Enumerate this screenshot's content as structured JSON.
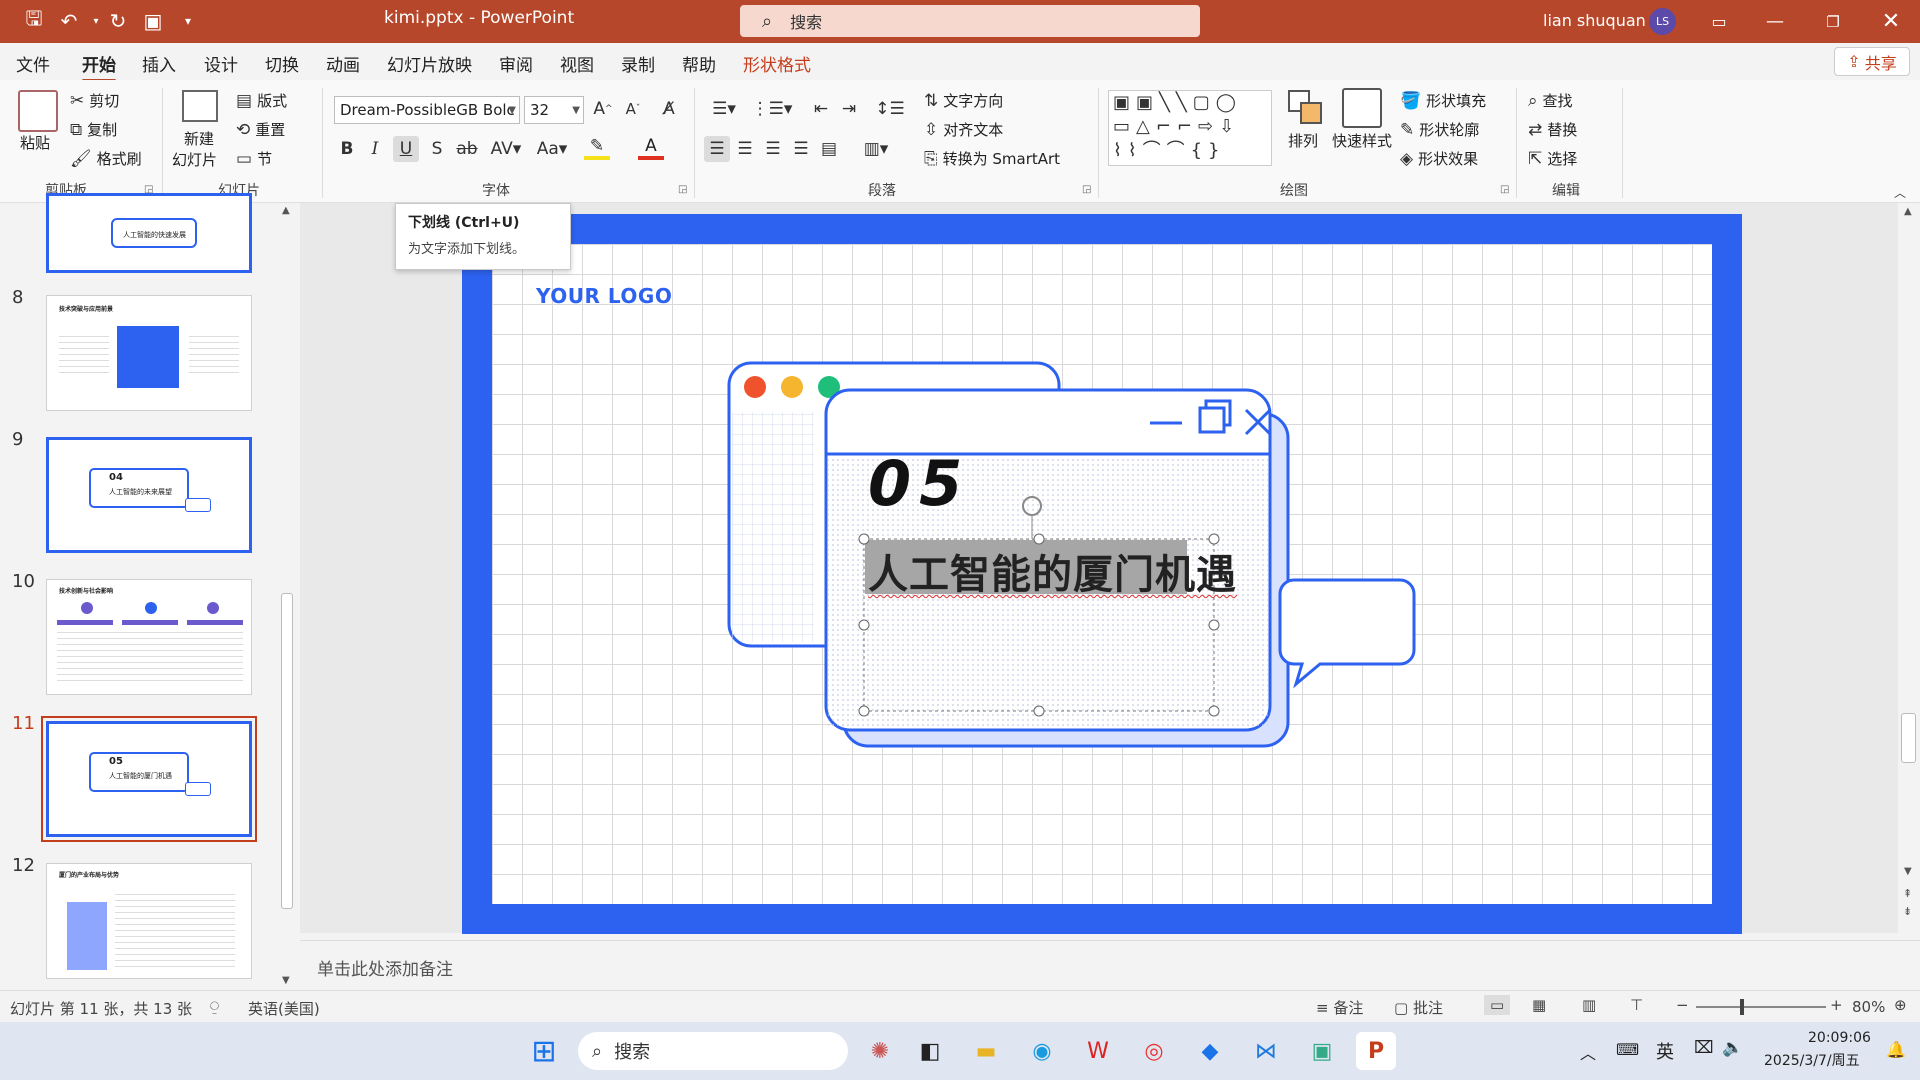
{
  "titlebar": {
    "title": "kimi.pptx  -  PowerPoint",
    "search_placeholder": "搜索",
    "user": "lian shuquan",
    "avatar": "LS"
  },
  "menu": {
    "tabs": [
      "文件",
      "开始",
      "插入",
      "设计",
      "切换",
      "动画",
      "幻灯片放映",
      "审阅",
      "视图",
      "录制",
      "帮助",
      "形状格式"
    ],
    "share": "共享"
  },
  "ribbon": {
    "clipboard": {
      "paste": "粘贴",
      "cut": "剪切",
      "copy": "复制",
      "format_painter": "格式刷",
      "label": "剪贴板"
    },
    "slides": {
      "new_slide_1": "新建",
      "new_slide_2": "幻灯片",
      "layout": "版式",
      "reset": "重置",
      "section": "节",
      "label": "幻灯片"
    },
    "font": {
      "name": "Dream-PossibleGB Bolc",
      "size": "32",
      "label": "字体"
    },
    "paragraph": {
      "text_direction": "文字方向",
      "align_text": "对齐文本",
      "smartart": "转换为 SmartArt",
      "label": "段落"
    },
    "drawing": {
      "arrange": "排列",
      "quick_styles": "快速样式",
      "fill": "形状填充",
      "outline": "形状轮廓",
      "effects": "形状效果",
      "label": "绘图"
    },
    "editing": {
      "find": "查找",
      "replace": "替换",
      "select": "选择",
      "label": "编辑"
    }
  },
  "tooltip": {
    "title": "下划线 (Ctrl+U)",
    "desc": "为文字添加下划线。"
  },
  "thumbs": {
    "n8": "8",
    "n9": "9",
    "n10": "10",
    "n11": "11",
    "n12": "12",
    "t8": "技术突破与应用前景",
    "t9_num": "04",
    "t9_title": "人工智能的未来展望",
    "t10": "技术创新与社会影响",
    "t11_num": "05",
    "t11_title": "人工智能的厦门机遇",
    "t12": "厦门的产业布局与优势",
    "t7": "人工智能的快速发展"
  },
  "slide": {
    "logo": "YOUR LOGO",
    "number": "05",
    "title": "人工智能的厦门机遇"
  },
  "notes": {
    "placeholder": "单击此处添加备注"
  },
  "status": {
    "slide_info": "幻灯片 第 11 张，共 13 张",
    "language": "英语(美国)",
    "notes": "备注",
    "comments": "批注",
    "zoom": "80%"
  },
  "taskbar": {
    "search": "搜索",
    "time": "20:09:06",
    "date": "2025/3/7/周五",
    "ime": "英"
  },
  "colors": {
    "accent": "#b7472a",
    "slide_blue": "#2d62f0"
  }
}
